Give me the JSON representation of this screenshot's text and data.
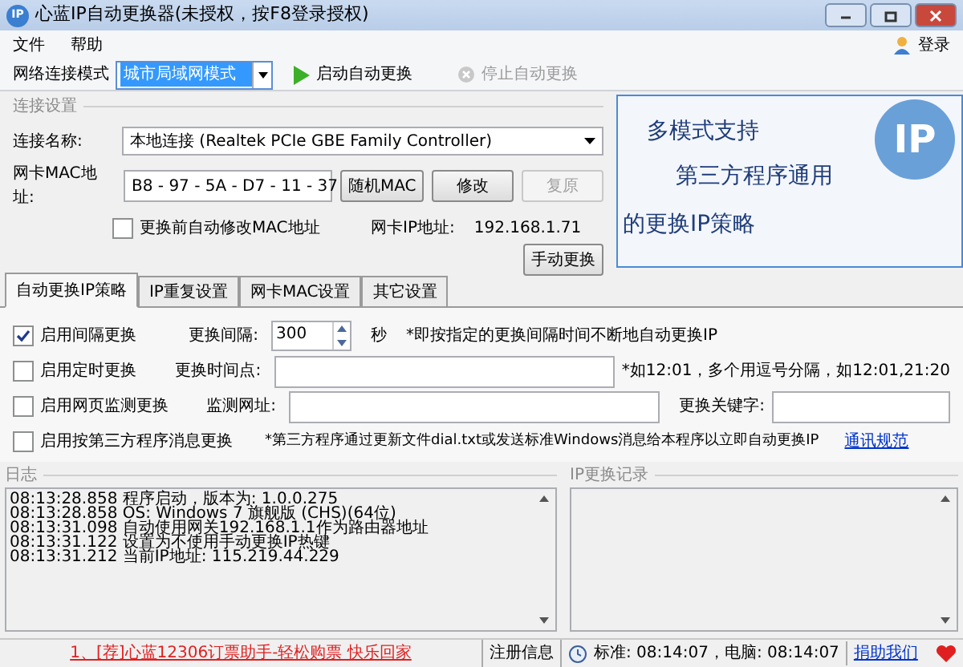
{
  "window": {
    "title": "心蓝IP自动更换器(未授权，按F8登录授权)",
    "logo_text": "IP"
  },
  "menu": [
    "文件",
    "帮助"
  ],
  "login_button": "登录",
  "toolbar": {
    "mode_label": "网络连接模式",
    "mode_value": "城市局域网模式",
    "start_button": "启动自动更换",
    "stop_button": {
      "label": "停止自动更换",
      "disabled": true
    }
  },
  "connection": {
    "title": "连接设置",
    "name_label": "连接名称:",
    "name_value": "本地连接 (Realtek PCIe GBE Family Controller)",
    "mac_label": "网卡MAC地址:",
    "mac_value": "B8 - 97 - 5A - D7 - 11 - 37",
    "buttons": [
      {
        "label": "随机MAC",
        "disabled": false
      },
      {
        "label": "修改",
        "disabled": false
      },
      {
        "label": "复原",
        "disabled": true
      }
    ],
    "auto_mac": {
      "label": "更换前自动修改MAC地址",
      "checked": false
    },
    "ip_label": "网卡IP地址:",
    "ip_value": "192.168.1.71",
    "manual_button": "手动更换"
  },
  "banner": {
    "lines": [
      "多模式支持",
      "第三方程序通用",
      "的更换IP策略"
    ],
    "logo_text": "IP"
  },
  "tabs": [
    {
      "label": "自动更换IP策略",
      "selected": true
    },
    {
      "label": "IP重复设置",
      "selected": false
    },
    {
      "label": "网卡MAC设置",
      "selected": false
    },
    {
      "label": "其它设置",
      "selected": false
    }
  ],
  "rules": [
    {
      "kind": "interval",
      "label": "启用间隔更换",
      "checked": true,
      "field_label": "更换间隔:",
      "value": "300",
      "unit": "秒",
      "note": "*即按指定的更换间隔时间不断地自动更换IP"
    },
    {
      "kind": "timed",
      "label": "启用定时更换",
      "checked": false,
      "field_label": "更换时间点:",
      "note": "*如12:01，多个用逗号分隔，如12:01,21:20"
    },
    {
      "kind": "web",
      "label": "启用网页监测更换",
      "checked": false,
      "field_label": "监测网址:",
      "field_label_2": "更换关键字:"
    },
    {
      "kind": "third",
      "label": "启用按第三方程序消息更换",
      "checked": false,
      "note": "*第三方程序通过更新文件dial.txt或发送标准Windows消息给本程序以立即自动更换IP",
      "link": "通讯规范"
    }
  ],
  "log": {
    "title": "日志",
    "lines": [
      "08:13:28.858 程序启动，版本为: 1.0.0.275",
      "08:13:28.858 OS: Windows 7 旗舰版 (CHS)(64位)",
      "08:13:31.098 自动使用网关192.168.1.1作为路由器地址",
      "08:13:31.122 设置为不使用手动更换IP热键",
      "08:13:31.212 当前IP地址: 115.219.44.229"
    ]
  },
  "ip_log": {
    "title": "IP更换记录"
  },
  "status_bar": {
    "ad_link": "1、[荐]心蓝12306订票助手-轻松购票 快乐回家",
    "register": "注册信息",
    "time": "标准: 08:14:07，电脑: 08:14:07",
    "donate": "捐助我们"
  }
}
